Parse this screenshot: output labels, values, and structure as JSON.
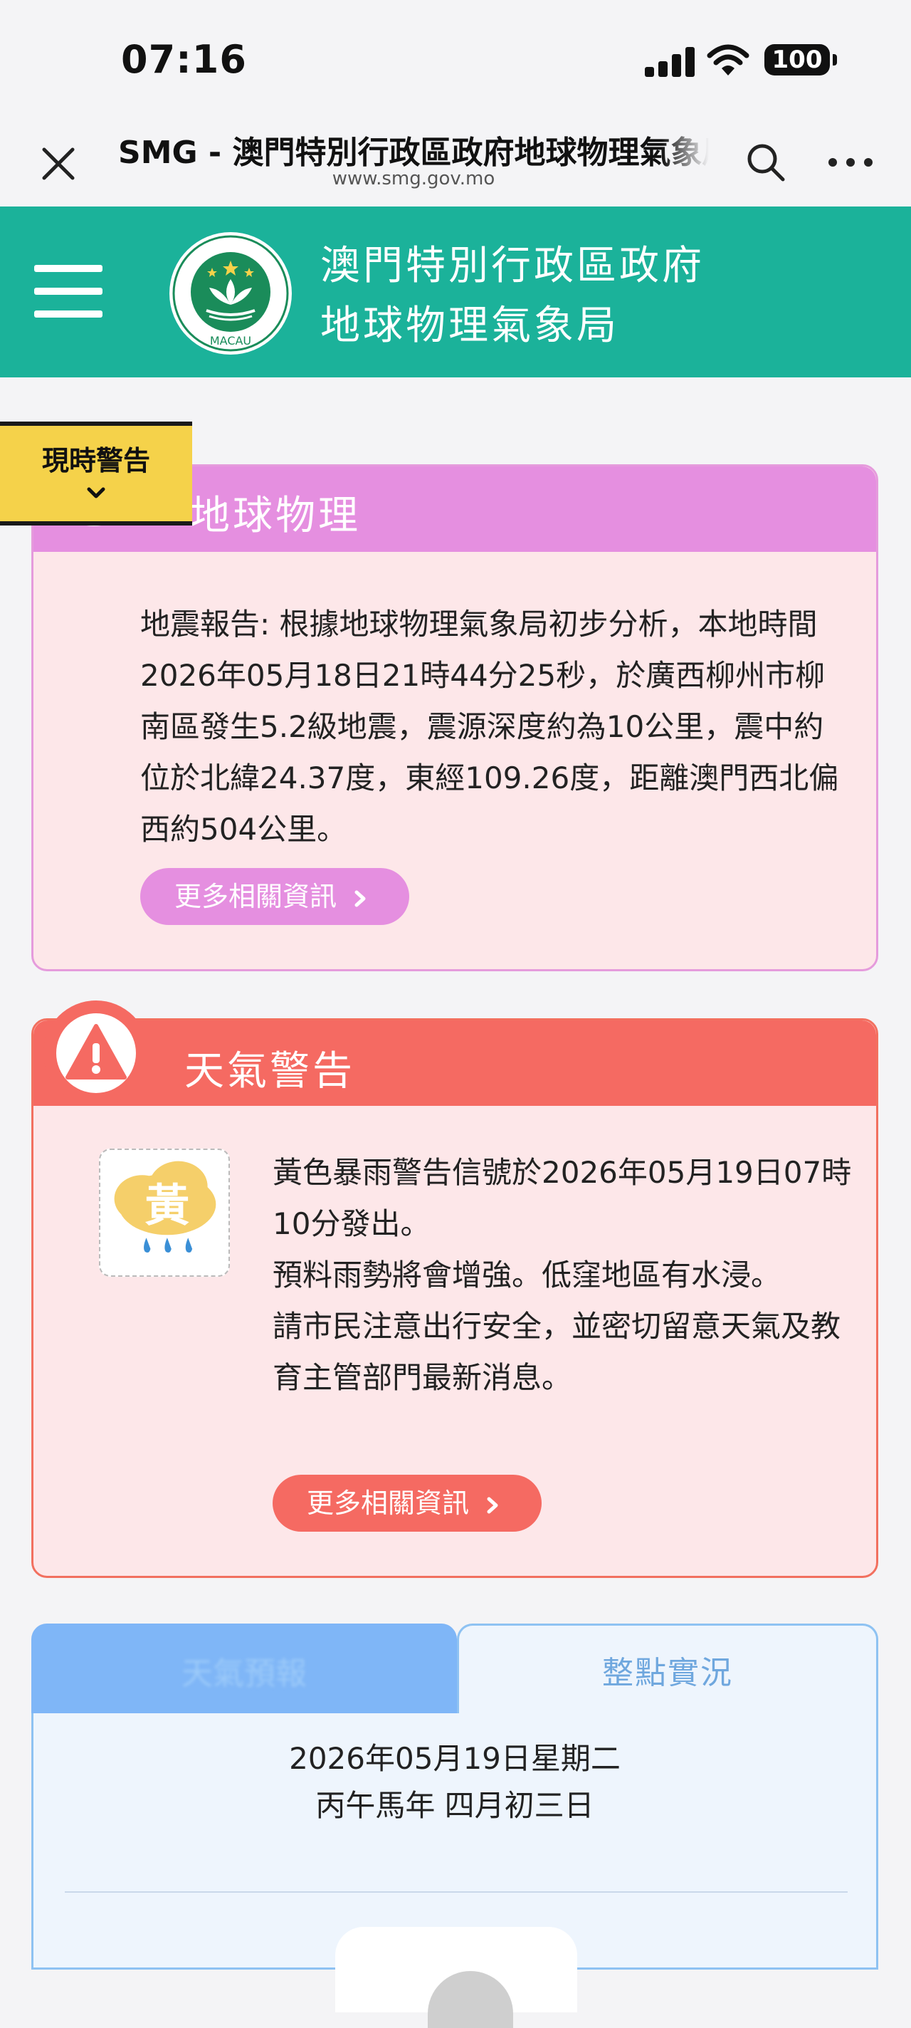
{
  "status": {
    "time": "07:16",
    "battery": "100"
  },
  "browser": {
    "title": "SMG - 澳門特別行政區政府地球物理氣象局",
    "url": "www.smg.gov.mo"
  },
  "header": {
    "org_line1": "澳門特別行政區政府",
    "org_line2": "地球物理氣象局",
    "emblem_text": "MACAU"
  },
  "current_warning": {
    "label": "現時警告"
  },
  "geophysics": {
    "title": "地球物理",
    "body": "地震報告: 根據地球物理氣象局初步分析，本地時間2026年05月18日21時44分25秒，於廣西柳州市柳南區發生5.2級地震，震源深度約為10公里，震中約位於北緯24.37度，東經109.26度，距離澳門西北偏西約504公里。",
    "more_label": "更多相關資訊",
    "accent": "#e58fe0"
  },
  "weather_warning": {
    "title": "天氣警告",
    "signal_char": "黃",
    "body_lines": [
      "黃色暴雨警告信號於2026年05月19日07時10分發出。",
      "預料雨勢將會增強。低窪地區有水浸。",
      "請市民注意出行安全，並密切留意天氣及教育主管部門最新消息。"
    ],
    "more_label": "更多相關資訊",
    "accent": "#f56a62"
  },
  "tabs": {
    "left_label": "天氣預報",
    "right_label": "整點實況"
  },
  "today": {
    "date": "2026年05月19日星期二",
    "lunar": "丙午馬年 四月初三日"
  }
}
